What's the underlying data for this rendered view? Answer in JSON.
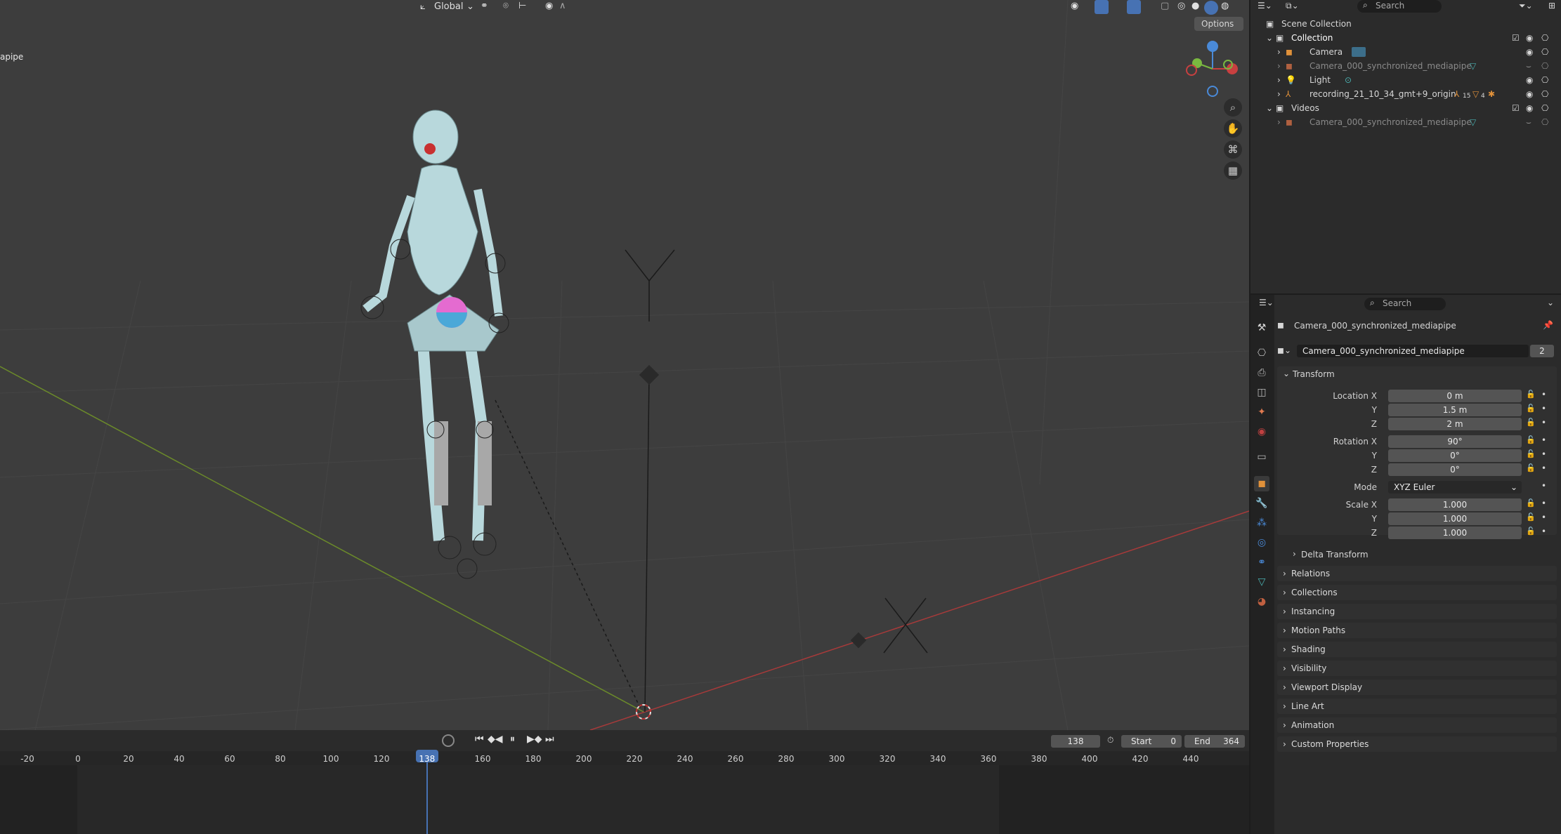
{
  "viewport": {
    "header": {
      "orientation": "Global",
      "options": "Options"
    },
    "overlay_text": "apipe",
    "gizmo": {
      "x": "X",
      "y": "Y",
      "z": "Z"
    }
  },
  "timeline": {
    "current_frame": "138",
    "start_label": "Start",
    "start_value": "0",
    "end_label": "End",
    "end_value": "364",
    "ticks": [
      "-20",
      "0",
      "20",
      "40",
      "60",
      "80",
      "100",
      "120",
      "138",
      "160",
      "180",
      "200",
      "220",
      "240",
      "260",
      "280",
      "300",
      "320",
      "340",
      "360",
      "380",
      "400",
      "420",
      "440"
    ]
  },
  "outliner": {
    "search_placeholder": "Search",
    "scene_collection": "Scene Collection",
    "items": [
      {
        "label": "Collection"
      },
      {
        "label": "Camera"
      },
      {
        "label": "Camera_000_synchronized_mediapipe"
      },
      {
        "label": "Light"
      },
      {
        "label": "recording_21_10_34_gmt+9_origin"
      },
      {
        "label": "Videos"
      },
      {
        "label": "Camera_000_synchronized_mediapipe"
      }
    ],
    "badge_a": "15",
    "badge_b": "4"
  },
  "properties": {
    "search_placeholder": "Search",
    "object_name": "Camera_000_synchronized_mediapipe",
    "data_name": "Camera_000_synchronized_mediapipe",
    "users_count": "2",
    "transform": {
      "title": "Transform",
      "location_x_label": "Location X",
      "y_label": "Y",
      "z_label": "Z",
      "location_x": "0 m",
      "location_y": "1.5 m",
      "location_z": "2 m",
      "rotation_x_label": "Rotation X",
      "rotation_x": "90°",
      "rotation_y": "0°",
      "rotation_z": "0°",
      "mode_label": "Mode",
      "mode_value": "XYZ Euler",
      "scale_x_label": "Scale X",
      "scale_x": "1.000",
      "scale_y": "1.000",
      "scale_z": "1.000",
      "delta": "Delta Transform"
    },
    "panels": [
      "Relations",
      "Collections",
      "Instancing",
      "Motion Paths",
      "Shading",
      "Visibility",
      "Viewport Display",
      "Line Art",
      "Animation",
      "Custom Properties"
    ]
  }
}
